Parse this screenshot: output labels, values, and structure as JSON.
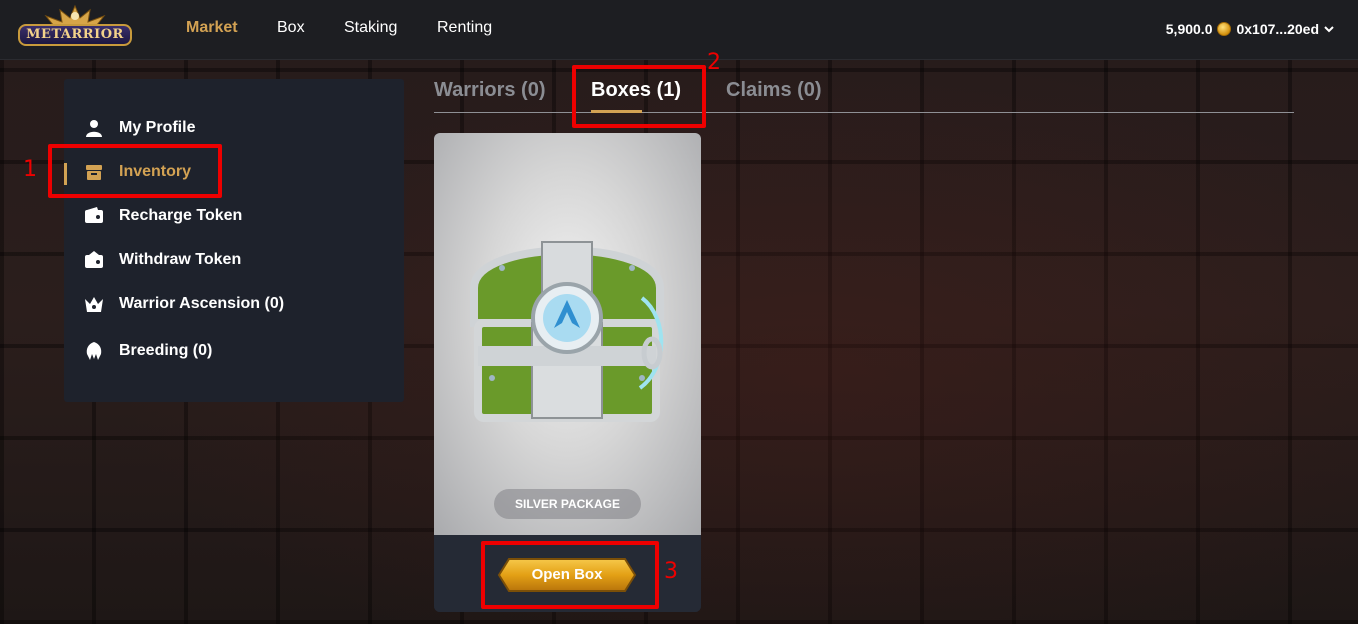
{
  "brand": {
    "logo_text": "METARRIOR"
  },
  "nav": {
    "items": [
      {
        "label": "Market",
        "active": true
      },
      {
        "label": "Box",
        "active": false
      },
      {
        "label": "Staking",
        "active": false
      },
      {
        "label": "Renting",
        "active": false
      }
    ]
  },
  "wallet": {
    "balance": "5,900.0",
    "address": "0x107...20ed",
    "coin_icon": "coin-icon",
    "menu_icon": "chevron-down-icon"
  },
  "sidebar": {
    "items": [
      {
        "label": "My Profile",
        "icon": "user-icon"
      },
      {
        "label": "Inventory",
        "icon": "box-icon",
        "active": true
      },
      {
        "label": "Recharge Token",
        "icon": "wallet-in-icon"
      },
      {
        "label": "Withdraw Token",
        "icon": "wallet-out-icon"
      },
      {
        "label": "Warrior Ascension (0)",
        "icon": "crown-icon"
      },
      {
        "label": "Breeding (0)",
        "icon": "helmet-icon"
      }
    ]
  },
  "tabs": [
    {
      "label": "Warriors (0)",
      "active": false
    },
    {
      "label": "Boxes (1)",
      "active": true
    },
    {
      "label": "Claims (0)",
      "active": false
    }
  ],
  "box_card": {
    "package_label": "SILVER PACKAGE",
    "open_label": "Open Box",
    "image": "silver-chest-image"
  },
  "annotations": [
    "1",
    "2",
    "3"
  ],
  "colors": {
    "accent": "#d3a253",
    "panel": "#1e222c",
    "callout": "#e00000"
  }
}
